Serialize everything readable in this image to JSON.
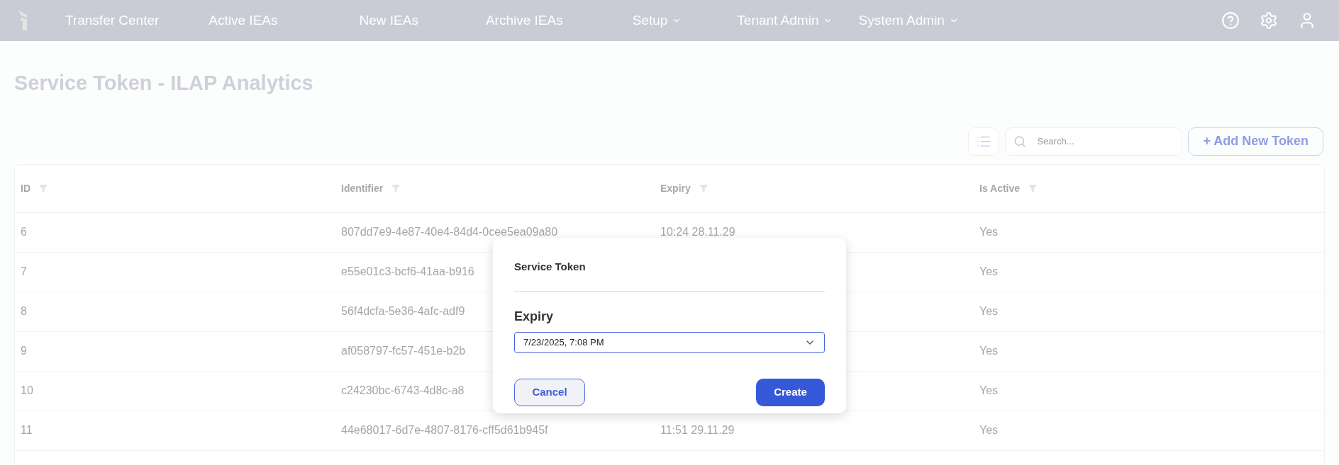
{
  "nav": {
    "items": [
      {
        "label": "Transfer Center",
        "dropdown": false
      },
      {
        "label": "Active IEAs",
        "dropdown": false
      },
      {
        "label": "New IEAs",
        "dropdown": false
      },
      {
        "label": "Archive IEAs",
        "dropdown": false
      },
      {
        "label": "Setup",
        "dropdown": true
      },
      {
        "label": "Tenant Admin",
        "dropdown": true
      },
      {
        "label": "System Admin",
        "dropdown": true
      }
    ]
  },
  "page": {
    "title": "Service Token - ILAP Analytics"
  },
  "toolbar": {
    "search": {
      "placeholder": "Search..."
    },
    "add_button": "+ Add New Token"
  },
  "table": {
    "columns": [
      "ID",
      "Identifier",
      "Expiry",
      "Is Active"
    ],
    "rows": [
      {
        "id": "6",
        "identifier": "807dd7e9-4e87-40e4-84d4-0cee5ea09a80",
        "expiry": "10:24 28.11.29",
        "is_active": "Yes"
      },
      {
        "id": "7",
        "identifier": "e55e01c3-bcf6-41aa-b916",
        "is_active": "Yes"
      },
      {
        "id": "8",
        "identifier": "56f4dcfa-5e36-4afc-adf9",
        "is_active": "Yes"
      },
      {
        "id": "9",
        "identifier": "af058797-fc57-451e-b2b",
        "is_active": "Yes"
      },
      {
        "id": "10",
        "identifier": "c24230bc-6743-4d8c-a8",
        "is_active": "Yes"
      },
      {
        "id": "11",
        "identifier": "44e68017-6d7e-4807-8176-cff5d61b945f",
        "expiry": "11:51 29.11.29",
        "is_active": "Yes"
      }
    ]
  },
  "dialog": {
    "title": "Service Token",
    "field_label": "Expiry",
    "field_value": "7/23/2025, 7:08 PM",
    "cancel": "Cancel",
    "create": "Create"
  }
}
